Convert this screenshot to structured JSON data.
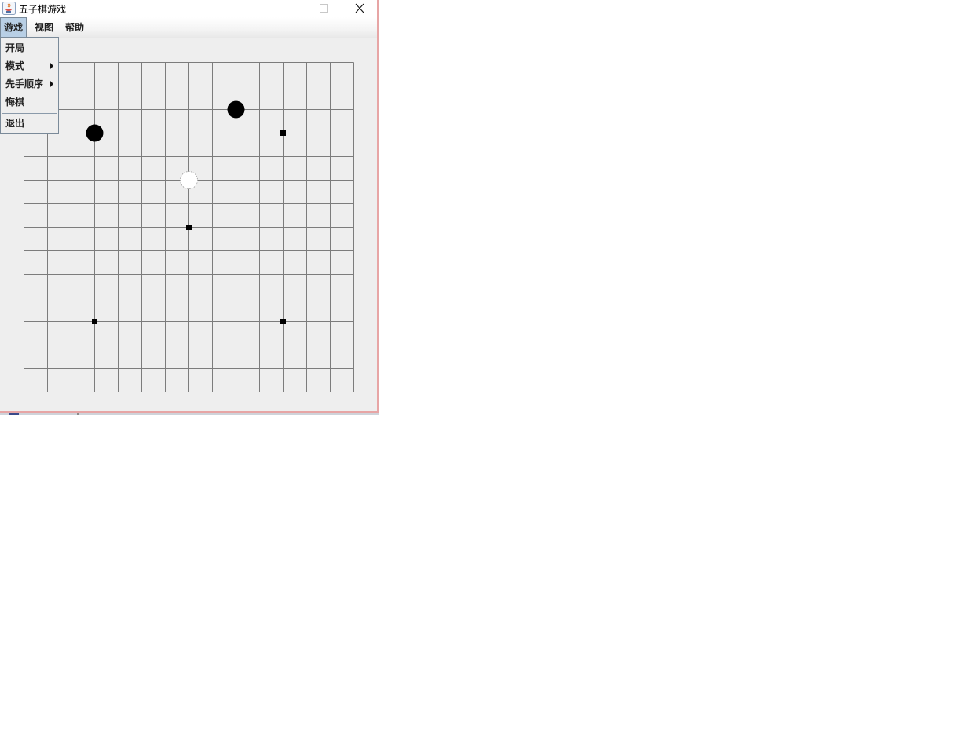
{
  "window": {
    "title": "五子棋游戏",
    "icon": "java-coffee-cup-icon",
    "controls": [
      "minimize-icon",
      "maximize-icon",
      "close-icon"
    ]
  },
  "menubar": {
    "items": [
      {
        "label": "游戏",
        "active": true
      },
      {
        "label": "视图"
      },
      {
        "label": "帮助"
      }
    ]
  },
  "game_menu": {
    "items": [
      {
        "label": "开局"
      },
      {
        "label": "模式",
        "submenu": true
      },
      {
        "label": "先手顺序",
        "submenu": true
      },
      {
        "label": "悔棋"
      },
      {
        "label": "退出"
      }
    ]
  },
  "board": {
    "columns": 15,
    "rows": 15,
    "star_points": [
      [
        11,
        3
      ],
      [
        7,
        7
      ],
      [
        3,
        11
      ],
      [
        11,
        11
      ],
      [
        3,
        3
      ]
    ],
    "stones": [
      {
        "color": "black",
        "col": 3,
        "row": 3
      },
      {
        "color": "black",
        "col": 9,
        "row": 2
      },
      {
        "color": "white",
        "col": 7,
        "row": 5
      }
    ],
    "line_color": "#7c7c7c",
    "background": "#eeeeee"
  }
}
